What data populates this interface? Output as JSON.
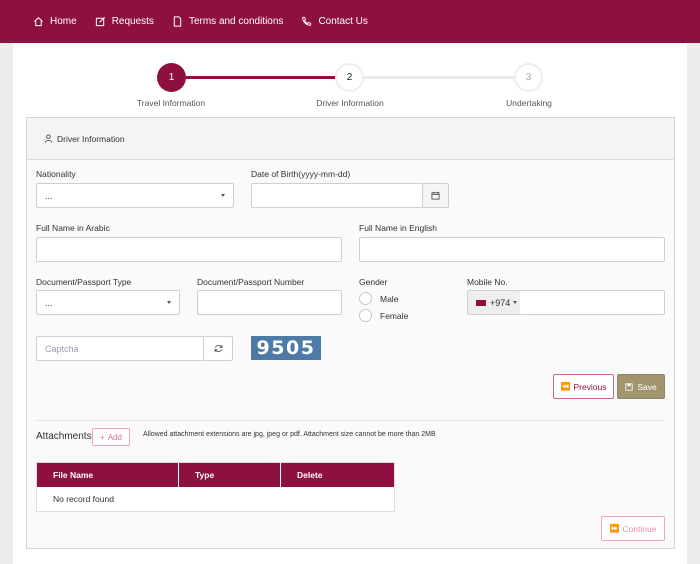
{
  "nav": {
    "home": "Home",
    "requests": "Requests",
    "terms": "Terms and conditions",
    "contact": "Contact Us"
  },
  "steps": [
    {
      "number": "1",
      "label": "Travel Information",
      "state": "completed"
    },
    {
      "number": "2",
      "label": "Driver Information",
      "state": "current"
    },
    {
      "number": "3",
      "label": "Undertaking",
      "state": "pending"
    }
  ],
  "form": {
    "header": "Driver Information",
    "nationality_label": "Nationality",
    "nationality_value": "...",
    "dob_label": "Date of Birth(yyyy-mm-dd)",
    "dob_value": "",
    "name_ar_label": "Full Name in Arabic",
    "name_ar_value": "",
    "name_en_label": "Full Name in English",
    "name_en_value": "",
    "doc_type_label": "Document/Passport Type",
    "doc_type_value": "...",
    "doc_number_label": "Document/Passport Number",
    "doc_number_value": "",
    "gender_label": "Gender",
    "gender_options": [
      "Male",
      "Female"
    ],
    "mobile_label": "Mobile No.",
    "mobile_code": "+974",
    "mobile_value": "",
    "captcha_placeholder": "Captcha",
    "captcha_code": "9505",
    "previous_label": "Previous",
    "save_label": "Save"
  },
  "attachments": {
    "title": "Attachments",
    "add_label": "Add",
    "note": "Allowed attachment extensions are jpg, jpeg or pdf. Attachment size cannot be more than 2MB",
    "columns": [
      "File Name",
      "Type",
      "Delete"
    ],
    "empty_text": "No record found"
  },
  "continue_label": "Continue",
  "colors": {
    "brand": "#8d1040",
    "save": "#a0956f",
    "captcha_bg": "#4e7aa6",
    "continue_border": "#f0a3bd"
  }
}
